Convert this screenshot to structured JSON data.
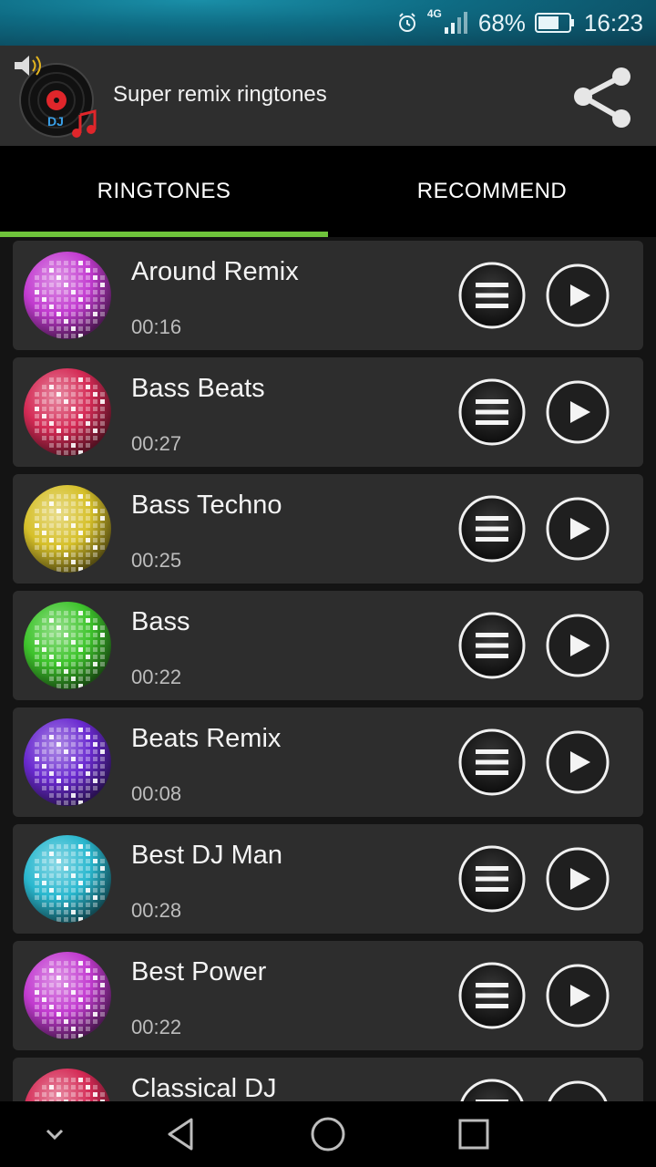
{
  "status_bar": {
    "network": "4G",
    "battery": "68%",
    "time": "16:23"
  },
  "app_bar": {
    "title": "Super remix ringtones",
    "logo_text": "DJ"
  },
  "tabs": [
    {
      "label": "RINGTONES",
      "selected": true
    },
    {
      "label": "RECOMMEND",
      "selected": false
    }
  ],
  "colors": {
    "accent": "#6fc33b",
    "card_bg": "#2d2d2d",
    "app_bar_bg": "#2e2e2e"
  },
  "ringtones": [
    {
      "title": "Around Remix",
      "duration": "00:16",
      "ball_color": "#c23bd0"
    },
    {
      "title": "Bass Beats",
      "duration": "00:27",
      "ball_color": "#d42a55"
    },
    {
      "title": "Bass Techno",
      "duration": "00:25",
      "ball_color": "#d6c02a"
    },
    {
      "title": "Bass",
      "duration": "00:22",
      "ball_color": "#3ec42c"
    },
    {
      "title": "Beats Remix",
      "duration": "00:08",
      "ball_color": "#6a2ad0"
    },
    {
      "title": "Best DJ Man",
      "duration": "00:28",
      "ball_color": "#2ab8cf"
    },
    {
      "title": "Best Power",
      "duration": "00:22",
      "ball_color": "#c23bd0"
    },
    {
      "title": "Classical DJ",
      "duration": "",
      "ball_color": "#d42a55"
    }
  ],
  "icons": {
    "menu": "menu-icon",
    "play": "play-icon",
    "share": "share-icon",
    "nav_down": "chevron-down-icon",
    "nav_back": "back-icon",
    "nav_home": "home-icon",
    "nav_recents": "recents-icon"
  }
}
